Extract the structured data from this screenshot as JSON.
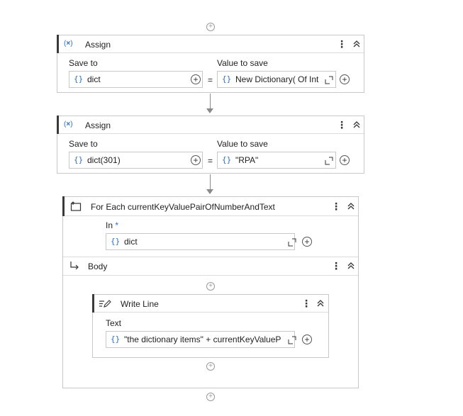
{
  "assign1": {
    "title": "Assign",
    "icon": "assign-x-icon",
    "save_to_label": "Save to",
    "value_label": "Value to save",
    "save_to_value": "dict",
    "value": "New Dictionary( Of Int",
    "equals": "="
  },
  "assign2": {
    "title": "Assign",
    "icon": "assign-x-icon",
    "save_to_label": "Save to",
    "value_label": "Value to save",
    "save_to_value": "dict(301)",
    "value": "\"RPA\"",
    "equals": "="
  },
  "foreach": {
    "title": "For Each currentKeyValuePairOfNumberAndText",
    "icon": "for-each-icon",
    "in_label": "In",
    "required_mark": "*",
    "in_value": "dict",
    "body_label": "Body",
    "body_icon": "body-arrow-icon"
  },
  "writeline": {
    "title": "Write Line",
    "icon": "write-line-icon",
    "text_label": "Text",
    "text_value": "\"the dictionary items\" + currentKeyValueP"
  },
  "symbols": {
    "braces": "{}",
    "add": "+",
    "kebab": "⋮"
  },
  "colors": {
    "accent": "#3a3a3a",
    "border": "#c8c8c8",
    "braces_blue": "#2f6fbf",
    "connector": "#8a8a8a"
  }
}
